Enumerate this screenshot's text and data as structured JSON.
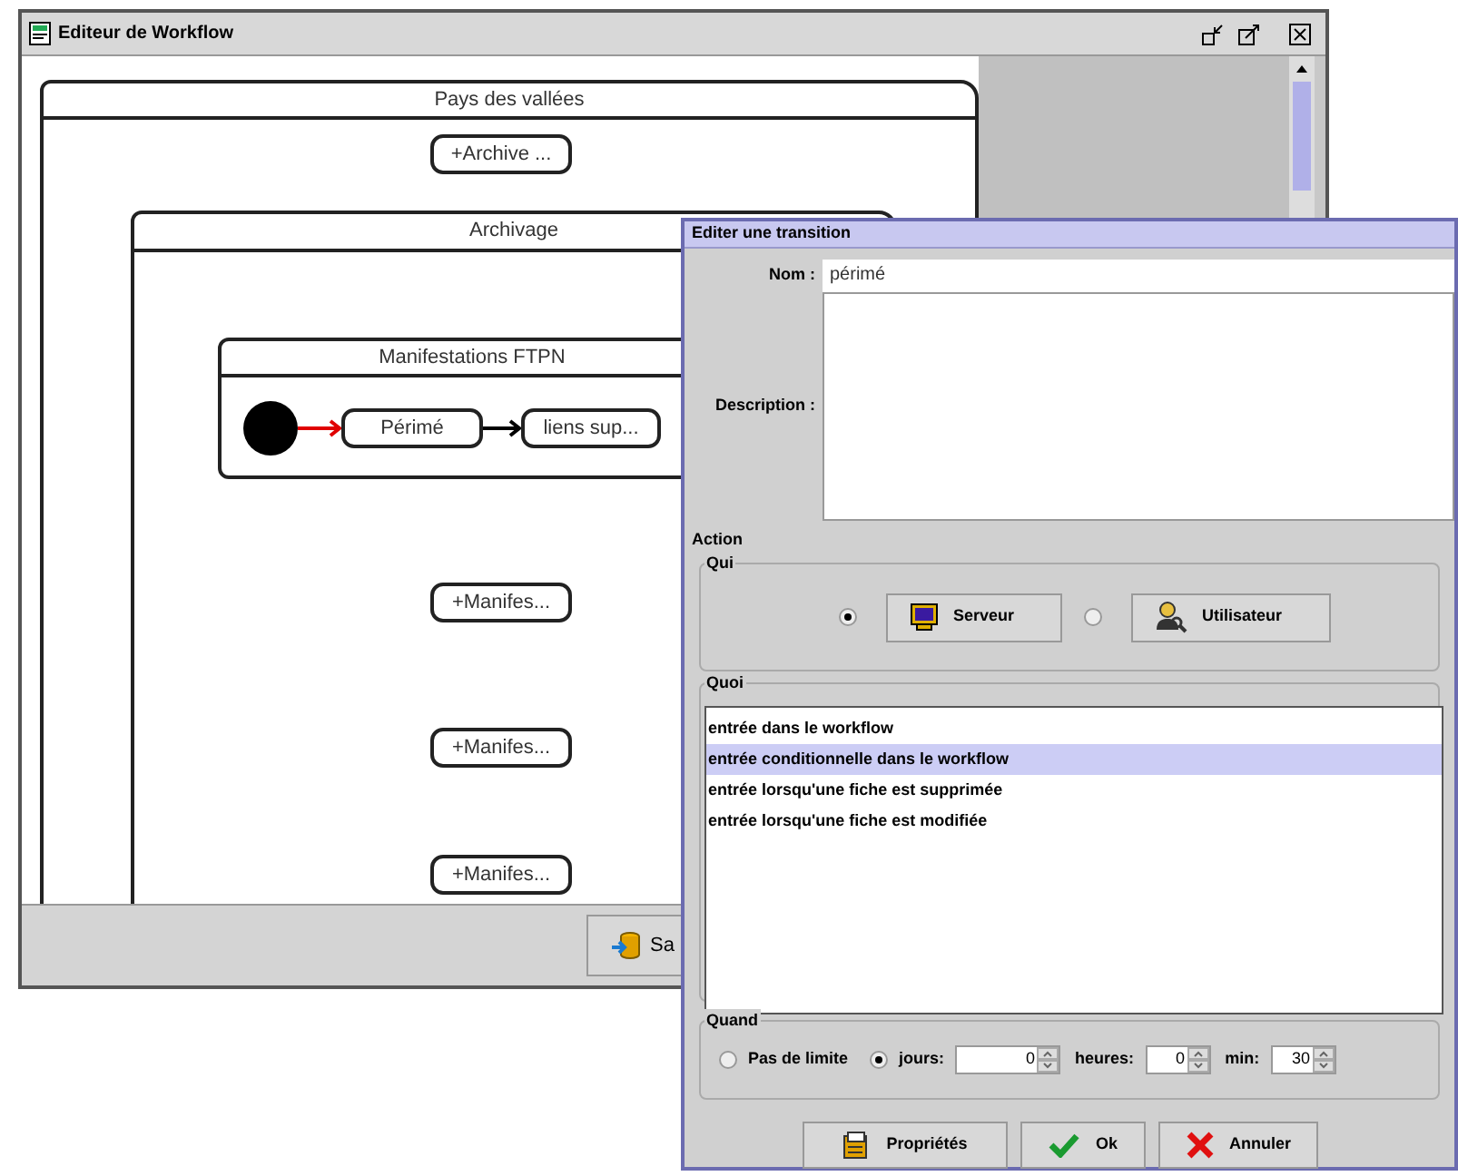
{
  "main_window": {
    "title": "Editeur de Workflow",
    "buttons": [
      {
        "label": "Sa"
      }
    ]
  },
  "diagram": {
    "containers": [
      {
        "title": "Pays des vallées"
      },
      {
        "title": "Archivage"
      },
      {
        "title": "Manifestations FTPN"
      }
    ],
    "states": [
      {
        "label": "Périmé"
      },
      {
        "label": "liens sup..."
      }
    ],
    "transitions": [
      {
        "selected": true
      },
      {
        "selected": false
      }
    ],
    "collapsed_nodes": [
      {
        "label": "+Archive ..."
      },
      {
        "label": "+Manifes..."
      },
      {
        "label": "+Manifes..."
      },
      {
        "label": "+Manifes..."
      }
    ]
  },
  "dialog": {
    "title": "Editer une transition",
    "name_label": "Nom :",
    "name_value": "périmé",
    "description_label": "Description :",
    "action": {
      "title": "Action",
      "qui": {
        "title": "Qui",
        "options": [
          {
            "label": "Serveur",
            "kind": "server",
            "selected": true
          },
          {
            "label": "Utilisateur",
            "kind": "user",
            "selected": false
          }
        ]
      },
      "quoi": {
        "title": "Quoi",
        "items": [
          {
            "label": "entrée dans le workflow",
            "selected": false
          },
          {
            "label": "entrée conditionnelle dans le workflow",
            "selected": true
          },
          {
            "label": "entrée lorsqu'une fiche est supprimée",
            "selected": false
          },
          {
            "label": "entrée lorsqu'une fiche est modifiée",
            "selected": false
          }
        ]
      },
      "quand": {
        "title": "Quand",
        "options": [
          {
            "label": "Pas de limite",
            "selected": false
          },
          {
            "label": "jours:",
            "selected": true
          }
        ],
        "spinners": [
          {
            "value": "0"
          },
          {
            "label": "heures:",
            "value": "0"
          },
          {
            "label": "min:",
            "value": "30"
          }
        ]
      }
    },
    "buttons": [
      {
        "label": "Propriétés",
        "kind": "properties"
      },
      {
        "label": "Ok",
        "kind": "ok"
      },
      {
        "label": "Annuler",
        "kind": "cancel"
      }
    ]
  }
}
